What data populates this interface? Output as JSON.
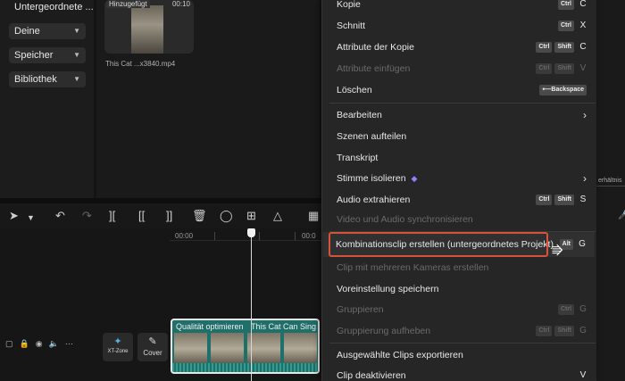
{
  "sidebar": {
    "header": "Untergeordnete ...",
    "items": [
      {
        "label": "Deine"
      },
      {
        "label": "Speicher"
      },
      {
        "label": "Bibliothek"
      }
    ]
  },
  "media": {
    "badge": "Hinzugefügt",
    "duration": "00:10",
    "filename": "This Cat ...x3840.mp4"
  },
  "timeline": {
    "ruler_start": "00:00",
    "ruler_mid": "00:0",
    "cover_label": "Cover",
    "tile_label": "XT-Zone",
    "clip_title_1": "Qualität optimieren",
    "clip_title_2": "This Cat Can Sing o"
  },
  "context_menu": {
    "items": [
      {
        "label": "Kopie",
        "keys": [
          "Ctrl"
        ],
        "letter": "C",
        "disabled": false
      },
      {
        "label": "Schnitt",
        "keys": [
          "Ctrl"
        ],
        "letter": "X",
        "disabled": false
      },
      {
        "label": "Attribute der Kopie",
        "keys": [
          "Ctrl",
          "Shift"
        ],
        "letter": "C",
        "disabled": false
      },
      {
        "label": "Attribute einfügen",
        "keys": [
          "Ctrl",
          "Shift"
        ],
        "letter": "V",
        "disabled": true
      },
      {
        "label": "Löschen",
        "keys": [
          "⟵Backspace"
        ],
        "letter": "",
        "disabled": false
      },
      {
        "label": "Bearbeiten",
        "submenu": true,
        "disabled": false
      },
      {
        "label": "Szenen aufteilen",
        "disabled": false
      },
      {
        "label": "Transkript",
        "disabled": false
      },
      {
        "label": "Stimme isolieren",
        "submenu": true,
        "disabled": false
      },
      {
        "label": "Audio extrahieren",
        "keys": [
          "Ctrl",
          "Shift"
        ],
        "letter": "S",
        "disabled": false
      },
      {
        "label": "Video und Audio synchronisieren",
        "disabled": true
      },
      {
        "label": "Kombinationsclip erstellen (untergeordnetes Projekt)",
        "keys": [
          "Alt"
        ],
        "letter": "G",
        "disabled": false
      },
      {
        "label": "Clip mit mehreren Kameras erstellen",
        "disabled": true
      },
      {
        "label": "Voreinstellung speichern",
        "disabled": false
      },
      {
        "label": "Gruppieren",
        "keys": [
          "Ctrl"
        ],
        "letter": "G",
        "disabled": true
      },
      {
        "label": "Gruppierung aufheben",
        "keys": [
          "Ctrl",
          "Shift"
        ],
        "letter": "G",
        "disabled": true
      },
      {
        "label": "Ausgewählte Clips exportieren",
        "disabled": false
      },
      {
        "label": "Clip deaktivieren",
        "letter": "V",
        "disabled": false
      }
    ]
  },
  "right_panel": {
    "label": "erhältnis"
  },
  "colors": {
    "highlight_border": "#d9503b",
    "clip_teal": "#1f6f6a",
    "menu_bg": "#262626"
  }
}
